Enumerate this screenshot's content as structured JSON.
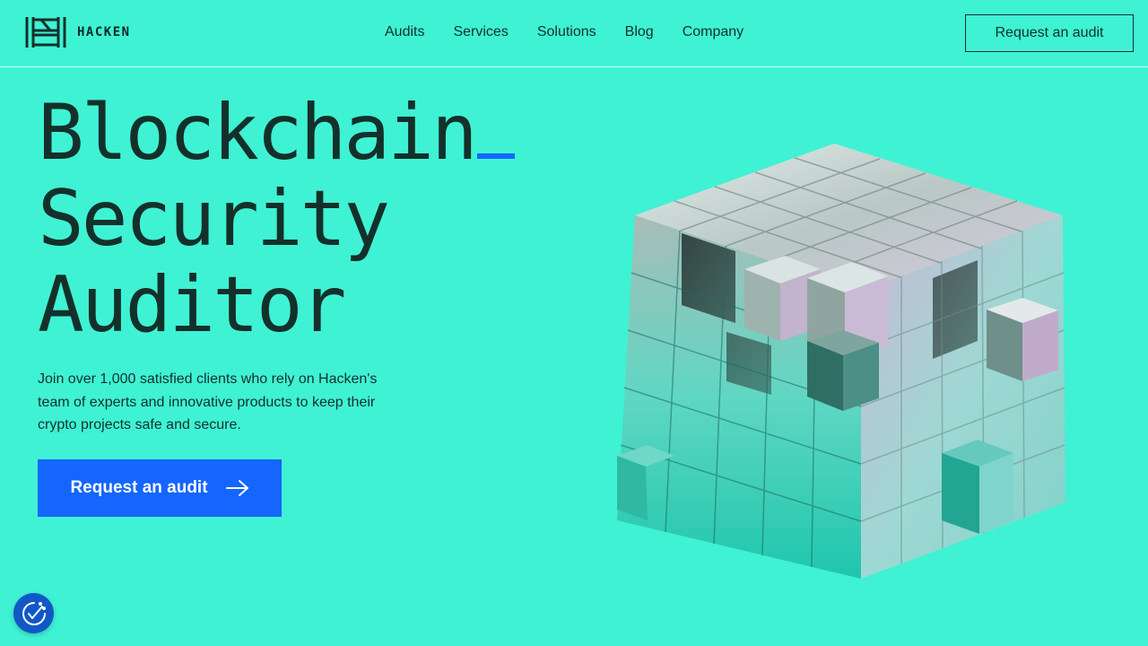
{
  "brand": {
    "name": "HACKEN"
  },
  "nav": {
    "items": [
      {
        "label": "Audits"
      },
      {
        "label": "Services"
      },
      {
        "label": "Solutions"
      },
      {
        "label": "Blog"
      },
      {
        "label": "Company"
      }
    ]
  },
  "header": {
    "cta_label": "Request an audit"
  },
  "hero": {
    "title_lines": [
      "Blockchain",
      "Security",
      "Auditor"
    ],
    "description": "Join over 1,000 satisfied clients who rely on Hacken's team of experts and innovative products to keep their crypto projects safe and secure.",
    "cta_label": "Request an audit"
  },
  "colors": {
    "background": "#3ff2d4",
    "accent": "#1565ff",
    "text": "#14302b",
    "badge": "#1158c7"
  },
  "icons": {
    "logo": "hacken-logo-icon",
    "cta_arrow": "arrow-right-icon",
    "consent": "cookie-consent-check-icon"
  }
}
